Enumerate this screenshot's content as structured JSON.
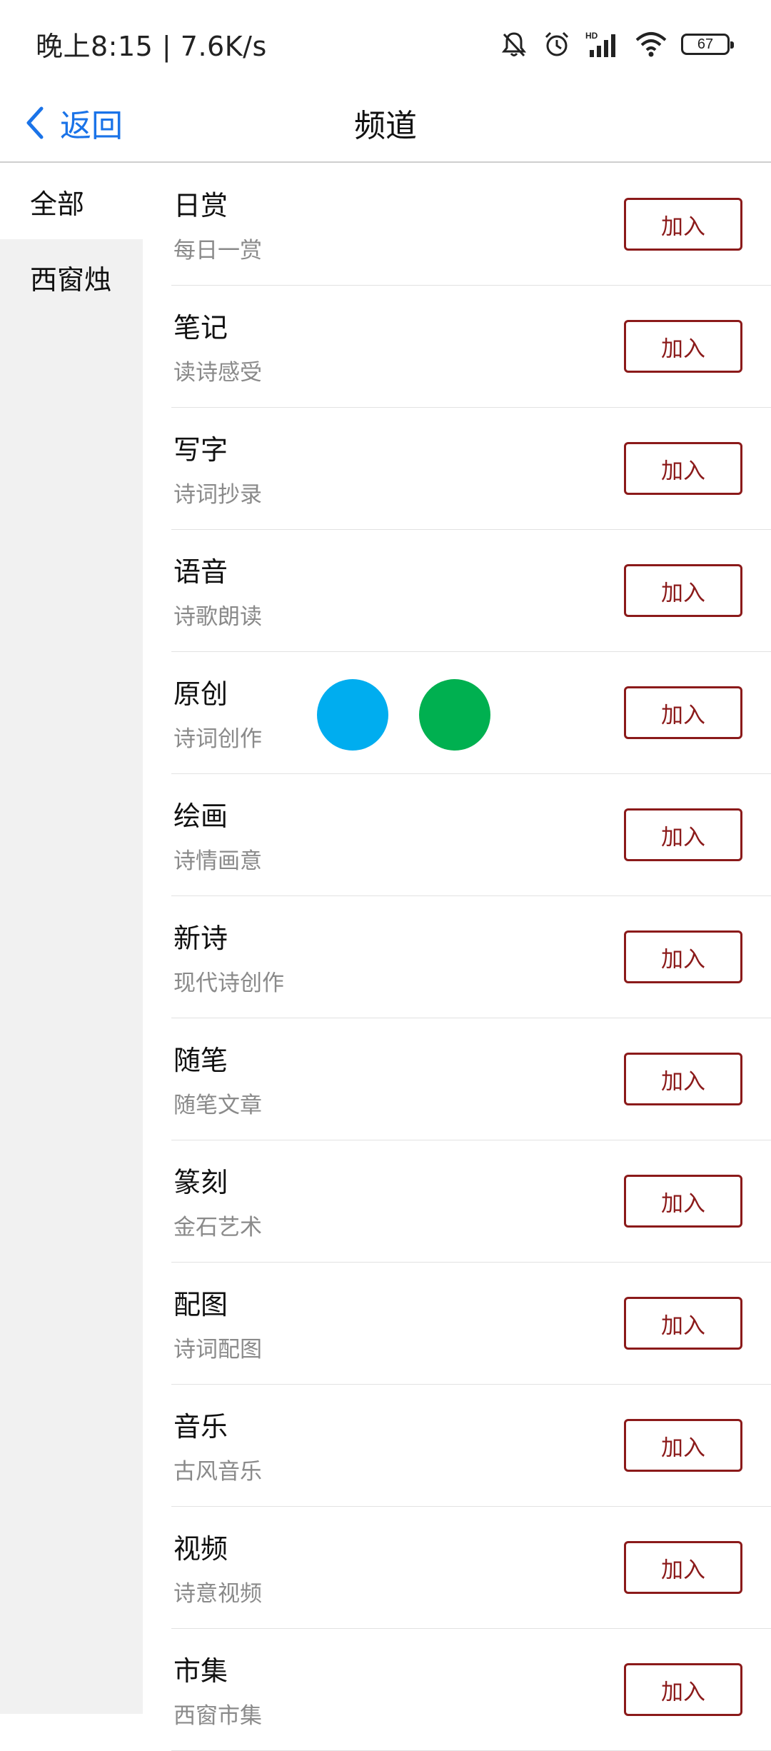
{
  "status_bar": {
    "time": "晚上8:15 | 7.6K/s",
    "battery": "67",
    "icons": [
      "bell-muted-icon",
      "alarm-icon",
      "hd-signal-icon",
      "wifi-icon",
      "battery-icon"
    ]
  },
  "header": {
    "back_label": "返回",
    "title": "频道"
  },
  "sidebar": {
    "items": [
      {
        "label": "全部",
        "active": true
      },
      {
        "label": "西窗烛",
        "active": false
      }
    ]
  },
  "channels": [
    {
      "title": "日赏",
      "subtitle": "每日一赏",
      "button": "加入"
    },
    {
      "title": "笔记",
      "subtitle": "读诗感受",
      "button": "加入"
    },
    {
      "title": "写字",
      "subtitle": "诗词抄录",
      "button": "加入"
    },
    {
      "title": "语音",
      "subtitle": "诗歌朗读",
      "button": "加入"
    },
    {
      "title": "原创",
      "subtitle": "诗词创作",
      "button": "加入"
    },
    {
      "title": "绘画",
      "subtitle": "诗情画意",
      "button": "加入"
    },
    {
      "title": "新诗",
      "subtitle": "现代诗创作",
      "button": "加入"
    },
    {
      "title": "随笔",
      "subtitle": "随笔文章",
      "button": "加入"
    },
    {
      "title": "篆刻",
      "subtitle": "金石艺术",
      "button": "加入"
    },
    {
      "title": "配图",
      "subtitle": "诗词配图",
      "button": "加入"
    },
    {
      "title": "音乐",
      "subtitle": "古风音乐",
      "button": "加入"
    },
    {
      "title": "视频",
      "subtitle": "诗意视频",
      "button": "加入"
    },
    {
      "title": "市集",
      "subtitle": "西窗市集",
      "button": "加入"
    }
  ],
  "colors": {
    "accent_blue": "#1a73e8",
    "button_red": "#8b1a1a",
    "dot_blue": "#00adef",
    "dot_green": "#00b050",
    "sidebar_bg": "#f1f1f1"
  }
}
